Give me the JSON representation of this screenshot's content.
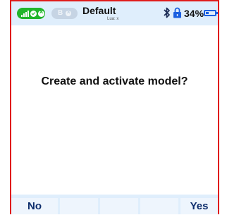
{
  "statusbar": {
    "model_name": "Default",
    "model_subtitle": "Lua: x",
    "battery_percent": "34%",
    "battery_level": 0.34,
    "connection_icons": [
      "signal-icon",
      "check-icon",
      "cross-icon"
    ],
    "bluetooth_letter": "B",
    "icons": [
      "bluetooth-icon",
      "lock-icon",
      "battery-icon"
    ]
  },
  "dialog": {
    "prompt": "Create and activate model?"
  },
  "buttons": {
    "no_label": "No",
    "yes_label": "Yes"
  },
  "colors": {
    "border": "#e01b1b",
    "bar_background": "#dfeefc",
    "connected_pill": "#21b52a",
    "accent": "#1a5fe0",
    "button_text": "#0d2d6c"
  }
}
